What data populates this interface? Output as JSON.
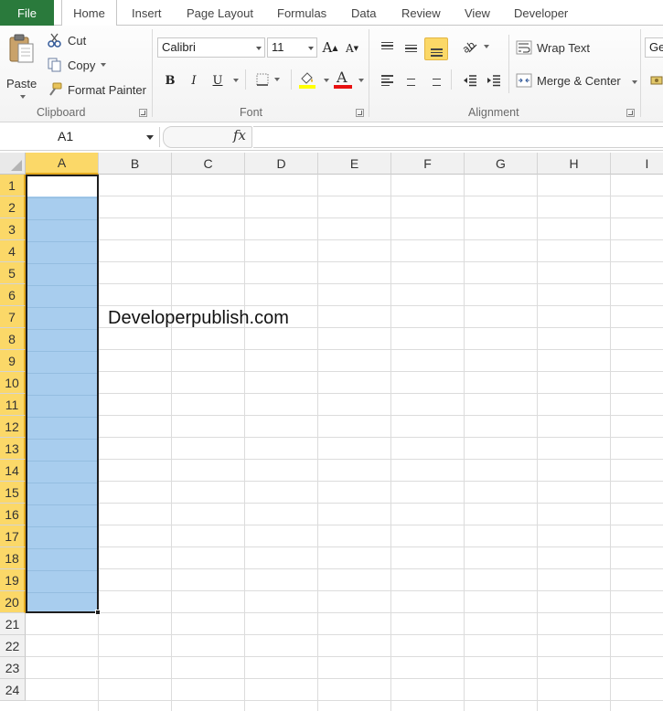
{
  "tabs": {
    "file": "File",
    "home": "Home",
    "insert": "Insert",
    "page_layout": "Page Layout",
    "formulas": "Formulas",
    "data": "Data",
    "review": "Review",
    "view": "View",
    "developer": "Developer"
  },
  "clipboard": {
    "paste": "Paste",
    "cut": "Cut",
    "copy": "Copy",
    "format_painter": "Format Painter",
    "label": "Clipboard"
  },
  "font": {
    "name": "Calibri",
    "size": "11",
    "bold": "B",
    "italic": "I",
    "underline": "U",
    "grow": "A",
    "shrink": "A",
    "color_glyph": "A",
    "label": "Font",
    "fill_color": "#ffff00",
    "font_color": "#e81010"
  },
  "alignment": {
    "wrap_text": "Wrap Text",
    "merge_center": "Merge & Center",
    "label": "Alignment"
  },
  "number": {
    "format_partial": "Ge"
  },
  "formula_bar": {
    "name_box": "A1",
    "fx": "fx",
    "value": ""
  },
  "sheet": {
    "columns": [
      "A",
      "B",
      "C",
      "D",
      "E",
      "F",
      "G",
      "H",
      "I"
    ],
    "rows": [
      "1",
      "2",
      "3",
      "4",
      "5",
      "6",
      "7",
      "8",
      "9",
      "10",
      "11",
      "12",
      "13",
      "14",
      "15",
      "16",
      "17",
      "18",
      "19",
      "20",
      "21",
      "22",
      "23",
      "24"
    ],
    "selected_column": "A",
    "selected_range": "A1:A20",
    "cell_B7": "Developerpublish.com",
    "selection_color": "#a8cdee",
    "header_highlight": "#fbd868"
  }
}
